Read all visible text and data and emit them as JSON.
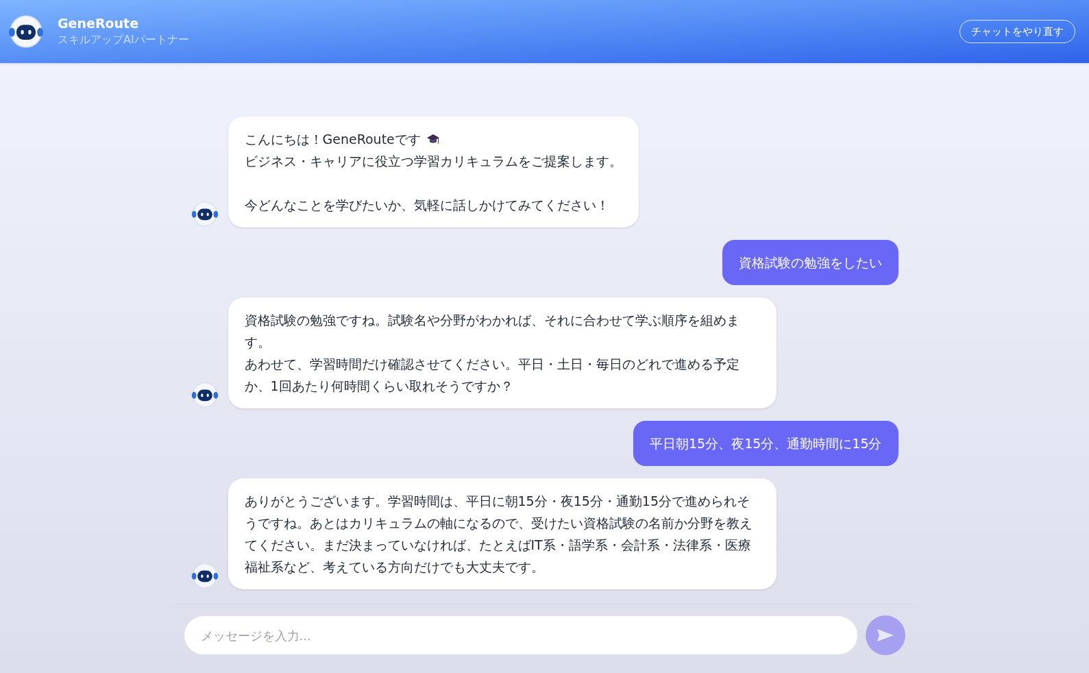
{
  "header": {
    "title": "GeneRoute",
    "subtitle": "スキルアップAIパートナー",
    "reset_button": "チャットをやり直す"
  },
  "messages": [
    {
      "kind": "bot",
      "cap_icon": true,
      "paragraphs": [
        [
          "こんにちは！GeneRouteです",
          "ビジネス・キャリアに役立つ学習カリキュラムをご提案します。"
        ],
        [
          "今どんなことを学びたいか、気軽に話しかけてみてください！"
        ]
      ]
    },
    {
      "kind": "user",
      "paragraphs": [
        [
          "資格試験の勉強をしたい"
        ]
      ]
    },
    {
      "kind": "bot",
      "cap_icon": false,
      "paragraphs": [
        [
          "資格試験の勉強ですね。試験名や分野がわかれば、それに合わせて学ぶ順序を組めます。",
          "あわせて、学習時間だけ確認させてください。平日・土日・毎日のどれで進める予定か、1回あたり何時間くらい取れそうですか？"
        ]
      ]
    },
    {
      "kind": "user",
      "paragraphs": [
        [
          "平日朝15分、夜15分、通勤時間に15分"
        ]
      ]
    },
    {
      "kind": "bot",
      "cap_icon": false,
      "paragraphs": [
        [
          "ありがとうございます。学習時間は、平日に朝15分・夜15分・通勤15分で進められそうですね。あとはカリキュラムの軸になるので、受けたい資格試験の名前か分野を教えてください。まだ決まっていなければ、たとえばIT系・語学系・会計系・法律系・医療福祉系など、考えている方向だけでも大丈夫です。"
        ]
      ]
    }
  ],
  "composer": {
    "placeholder": "メッセージを入力..."
  }
}
